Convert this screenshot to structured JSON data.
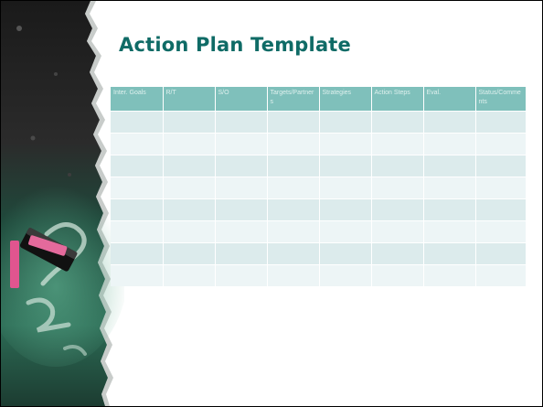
{
  "slide": {
    "title": "Action Plan Template"
  },
  "table": {
    "headers": [
      "Inter. Goals",
      "R/T",
      "S/O",
      "Targets/Partners",
      "Strategies",
      "Action Steps",
      "Eval.",
      "Status/Comments"
    ],
    "row_count": 8
  },
  "colors": {
    "title": "#0f6b66",
    "header_bg": "#7fc0bb",
    "row_dark": "#dcebec",
    "row_light": "#edf5f6"
  }
}
